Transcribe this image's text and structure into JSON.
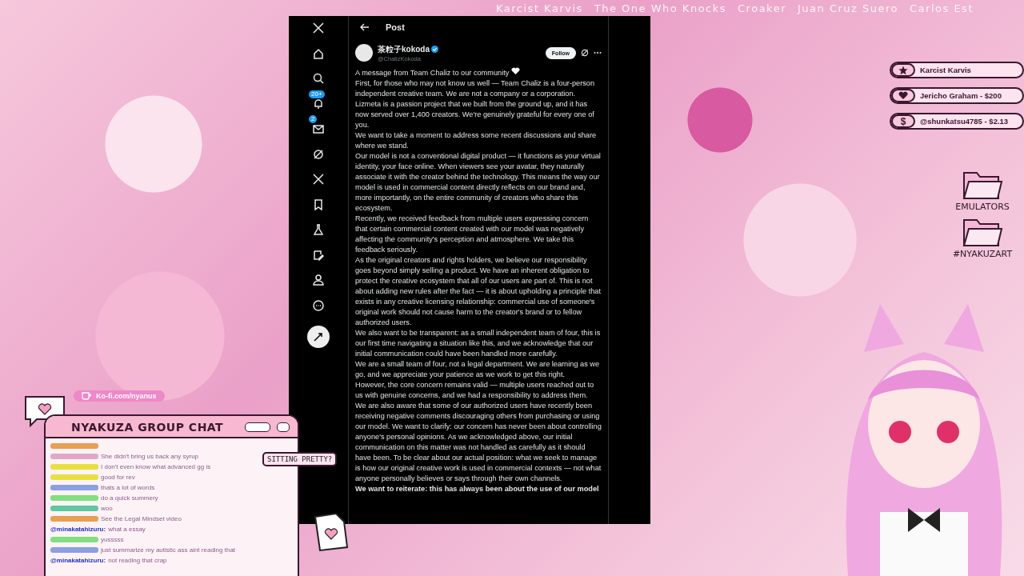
{
  "ticker": [
    "Karcist Karvis",
    "The One Who Knocks",
    "Croaker",
    "Juan Cruz Suero",
    "Carlos Est"
  ],
  "browser": {
    "nav": [
      {
        "kind": "x"
      },
      {
        "kind": "home"
      },
      {
        "kind": "search"
      },
      {
        "kind": "bell",
        "badge": "20+"
      },
      {
        "kind": "mail",
        "badge": "2"
      },
      {
        "kind": "slash"
      },
      {
        "kind": "x"
      },
      {
        "kind": "bookmark"
      },
      {
        "kind": "flask"
      },
      {
        "kind": "edit"
      },
      {
        "kind": "person"
      },
      {
        "kind": "more"
      },
      {
        "kind": "post"
      }
    ],
    "header": {
      "title": "Post"
    },
    "author": {
      "name": "茶粒子kokoda",
      "handle": "@ChalizKokoda",
      "follow": "Follow"
    },
    "paragraphs": [
      {
        "text": "A message from Team Chaliz to our community",
        "kind": "heart"
      },
      {
        "text": "First, for those who may not know us well — Team Chaliz is a four-person independent creative team. We are not a company or a corporation. Lizmeta is a passion project that we built from the ground up, and it has now served over 1,400 creators. We're genuinely grateful for every one of you.",
        "kind": "plain"
      },
      {
        "text": "We want to take a moment to address some recent discussions and share where we stand.",
        "kind": "plain"
      },
      {
        "text": "Our model is not a conventional digital product — it functions as your virtual identity, your face online. When viewers see your avatar, they naturally associate it with the creator behind the technology. This means the way our model is used in commercial content directly reflects on our brand and, more importantly, on the entire community of creators who share this ecosystem.",
        "kind": "plain"
      },
      {
        "text": "Recently, we received feedback from multiple users expressing concern that certain commercial content created with our model was negatively affecting the community's perception and atmosphere. We take this feedback seriously.",
        "kind": "plain"
      },
      {
        "text": "As the original creators and rights holders, we believe our responsibility goes beyond simply selling a product. We have an inherent obligation to protect the creative ecosystem that all of our users are part of. This is not about adding new rules after the fact — it is about upholding a principle that exists in any creative licensing relationship: commercial use of someone's original work should not cause harm to the creator's brand or to fellow authorized users.",
        "kind": "plain"
      },
      {
        "text": "We also want to be transparent: as a small independent team of four, this is our first time navigating a situation like this, and we acknowledge that our initial communication could have been handled more carefully.",
        "kind": "plain"
      },
      {
        "text": "We are a small team of four, not a legal department. We are learning as we go, and we appreciate your patience as we work to get this right.",
        "kind": "plain"
      },
      {
        "text": "However, the core concern remains valid — multiple users reached out to us with genuine concerns, and we had a responsibility to address them.",
        "kind": "plain"
      },
      {
        "text": "We are also aware that some of our authorized users have recently been receiving negative comments discouraging others from purchasing or using our model. We want to clarify: our concern has never been about controlling anyone's personal opinions. As we acknowledged above, our initial communication on this matter was not handled as carefully as it should have been. To be clear about our actual position: what we seek to manage is how our original creative work is used in commercial contexts — not what anyone personally believes or says through their own channels.",
        "kind": "plain"
      },
      {
        "text": "We want to reiterate: this has always been about the use of our model",
        "kind": "bold"
      }
    ]
  },
  "donations": [
    {
      "kind": "star",
      "text": "Karcist Karvis"
    },
    {
      "kind": "heart",
      "text": "Jericho Graham - $200"
    },
    {
      "kind": "glyph",
      "glyph": "$",
      "text": "@shunkatsu4785 - $2.13"
    }
  ],
  "desktop": [
    "EMULATORS",
    "#NYAKUZART"
  ],
  "kofi": "Ko-fi.com/nyanus",
  "chat": {
    "title": "NYAKUZA GROUP CHAT",
    "bubble": "SITTING PRETTY?",
    "messages": [
      {
        "color": "#e8a050"
      },
      {
        "color": "#e0a8c8",
        "text": "She didn't bring us back any syrup"
      },
      {
        "color": "#e8e040",
        "text": "I don't even know what advanced gg is"
      },
      {
        "color": "#e8e040",
        "text": "good for rev"
      },
      {
        "color": "#8aa0e0",
        "text": "thats a lot of words"
      },
      {
        "color": "#80e080",
        "text": "do a quick summery"
      },
      {
        "color": "#60c8a0",
        "text": "woo"
      },
      {
        "color": "#e8a050",
        "text": "See the Legal Mindset video"
      },
      {
        "user": "@minakatahizuru:",
        "color": "#2030c0",
        "text": "what a essay"
      },
      {
        "color": "#80e080",
        "text": "yusssss"
      },
      {
        "color": "#8aa0e0",
        "text": "just summarize my autistic ass aint reading that"
      },
      {
        "user": "@minakatahizuru:",
        "color": "#2030c0",
        "text": "not reading that crap"
      }
    ]
  }
}
